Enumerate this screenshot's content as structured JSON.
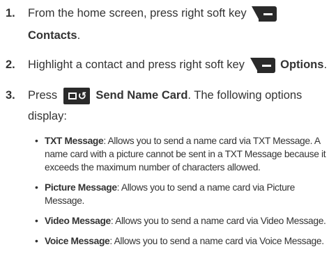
{
  "steps": [
    {
      "number": "1.",
      "text_before": "From the home screen, press right soft key",
      "icon": "right-soft-key-icon",
      "bold": "Contacts",
      "text_after": "."
    },
    {
      "number": "2.",
      "text_before": "Highlight a contact and press right soft key",
      "icon": "right-soft-key-icon",
      "bold": "Options",
      "text_after": "."
    },
    {
      "number": "3.",
      "text_before": "Press",
      "icon": "send-key-icon",
      "bold": "Send Name Card",
      "text_after": ". The following options",
      "continuation": "display:"
    }
  ],
  "bullets": [
    {
      "term": "TXT Message",
      "desc": ": Allows you to send a name card via TXT Message. A name card with a picture cannot be sent in a TXT Message because it exceeds the maximum number of characters allowed."
    },
    {
      "term": "Picture Message",
      "desc": ": Allows you to send a name card via Picture Message."
    },
    {
      "term": "Video Message",
      "desc": ": Allows you to send a name card via Video Message."
    },
    {
      "term": "Voice Message",
      "desc": ": Allows you to send a name card via Voice Message."
    }
  ],
  "bullet_glyph": "•",
  "colors": {
    "text": "#333333",
    "key": "#2a2a2a"
  }
}
